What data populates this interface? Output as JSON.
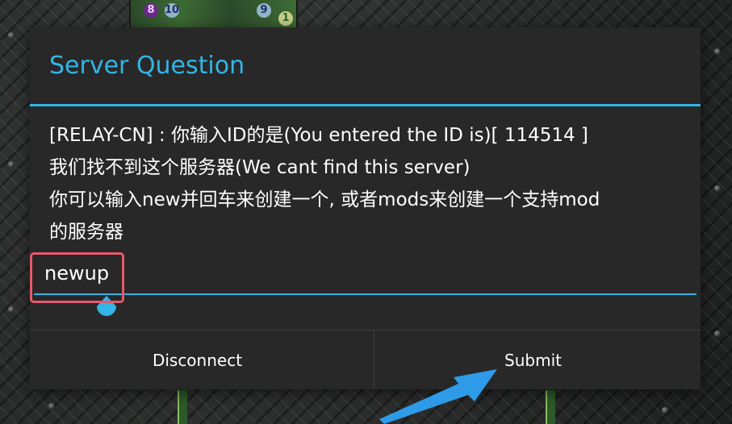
{
  "background": {
    "map_numbers": [
      "8",
      "10",
      "9",
      "1"
    ]
  },
  "dialog": {
    "title": "Server Question",
    "message_lines": [
      "[RELAY-CN] : 你输入ID的是(You entered the ID is)[ 114514 ]",
      "我们找不到这个服务器(We cant find this server)",
      "你可以输入new并回车来创建一个, 或者mods来创建一个支持mod",
      "的服务器"
    ],
    "input_value": "newup",
    "buttons": {
      "disconnect_label": "Disconnect",
      "submit_label": "Submit"
    }
  },
  "colors": {
    "accent": "#33b5e5",
    "highlight": "#e8586c",
    "dialog_bg": "#282828",
    "annotation_arrow": "#2e9be8"
  },
  "icons": {
    "cursor_handle": "text-cursor-handle-icon",
    "annotation_arrow": "arrow-pointer-icon"
  }
}
